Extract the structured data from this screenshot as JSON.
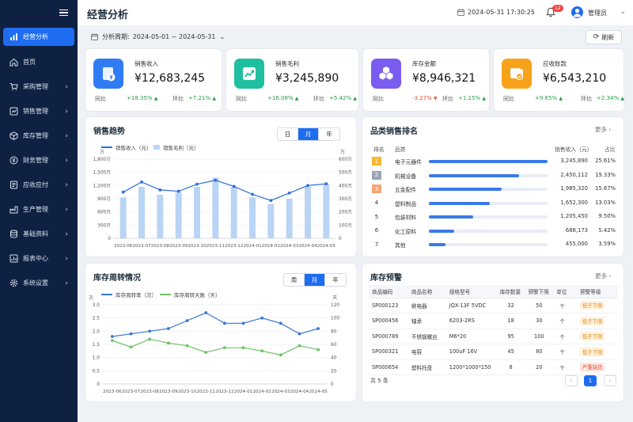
{
  "sidebar": {
    "items": [
      {
        "label": "经营分析",
        "icon": "chart-icon",
        "active": true,
        "arrow": false
      },
      {
        "label": "首页",
        "icon": "home-icon",
        "active": false,
        "arrow": false
      },
      {
        "label": "采购管理",
        "icon": "cart-icon",
        "active": false,
        "arrow": true
      },
      {
        "label": "销售管理",
        "icon": "sales-icon",
        "active": false,
        "arrow": true
      },
      {
        "label": "库存管理",
        "icon": "box-icon",
        "active": false,
        "arrow": true
      },
      {
        "label": "财务管理",
        "icon": "finance-icon",
        "active": false,
        "arrow": true
      },
      {
        "label": "应收应付",
        "icon": "invoice-icon",
        "active": false,
        "arrow": true
      },
      {
        "label": "生产管理",
        "icon": "production-icon",
        "active": false,
        "arrow": true
      },
      {
        "label": "基础资料",
        "icon": "database-icon",
        "active": false,
        "arrow": true
      },
      {
        "label": "报表中心",
        "icon": "report-icon",
        "active": false,
        "arrow": true
      },
      {
        "label": "系统设置",
        "icon": "gear-icon",
        "active": false,
        "arrow": true
      }
    ],
    "arrow_glyph": "›"
  },
  "header": {
    "title": "经营分析",
    "datetime": "2024-05-31 17:30:25",
    "notify_count": "12",
    "user": "管理员",
    "user_chevron": "⌄"
  },
  "toolbar": {
    "period_label": "分析周期:",
    "period_value": "2024-05-01 ~ 2024-05-31",
    "period_chevron": "⌄",
    "refresh_label": "刷新",
    "refresh_icon": "⟳"
  },
  "kpis": [
    {
      "label": "销售收入",
      "value": "¥12,683,245",
      "yoy_label": "同比",
      "yoy": "+18.35%",
      "yoy_dir": "up",
      "mom_label": "环比",
      "mom": "+7.21%",
      "mom_dir": "up",
      "color": "#2f7cf5",
      "icon": "money-icon"
    },
    {
      "label": "销售毛利",
      "value": "¥3,245,890",
      "yoy_label": "同比",
      "yoy": "+16.08%",
      "yoy_dir": "up",
      "mom_label": "环比",
      "mom": "+5.42%",
      "mom_dir": "up",
      "color": "#1fc0a0",
      "icon": "trend-icon"
    },
    {
      "label": "库存金额",
      "value": "¥8,946,321",
      "yoy_label": "同比",
      "yoy": "-3.27%",
      "yoy_dir": "down",
      "mom_label": "环比",
      "mom": "+1.15%",
      "mom_dir": "up",
      "color": "#7b5cf0",
      "icon": "cubes-icon"
    },
    {
      "label": "应收账款",
      "value": "¥6,543,210",
      "yoy_label": "同比",
      "yoy": "+9.65%",
      "yoy_dir": "up",
      "mom_label": "环比",
      "mom": "+2.34%",
      "mom_dir": "up",
      "color": "#f7a21b",
      "icon": "wallet-icon"
    }
  ],
  "sales_trend": {
    "title": "销售趋势",
    "tabs": [
      "日",
      "月",
      "年"
    ],
    "active_tab": 1,
    "legend": [
      "销售收入（元）",
      "销售毛利（元）"
    ],
    "left_unit": "万",
    "right_unit": "万"
  },
  "category_rank": {
    "title": "品类销售排名",
    "more": "更多 ›",
    "headers": [
      "排名",
      "品类",
      "销售收入（元）",
      "占比"
    ],
    "rows": [
      {
        "rank": "1",
        "name": "电子元器件",
        "value": "3,245,890",
        "pct": "25.61%",
        "fill": 1.0
      },
      {
        "rank": "2",
        "name": "机械设备",
        "value": "2,450,112",
        "pct": "19.33%",
        "fill": 0.76
      },
      {
        "rank": "3",
        "name": "五金配件",
        "value": "1,985,320",
        "pct": "15.67%",
        "fill": 0.61
      },
      {
        "rank": "4",
        "name": "塑料制品",
        "value": "1,652,300",
        "pct": "13.03%",
        "fill": 0.51
      },
      {
        "rank": "5",
        "name": "包装材料",
        "value": "1,205,450",
        "pct": "9.50%",
        "fill": 0.37
      },
      {
        "rank": "6",
        "name": "化工原料",
        "value": "688,173",
        "pct": "5.42%",
        "fill": 0.21
      },
      {
        "rank": "7",
        "name": "其他",
        "value": "455,000",
        "pct": "3.59%",
        "fill": 0.14
      }
    ],
    "rank_colors": [
      "#f7b733",
      "#9aa5b5",
      "#f4a571"
    ]
  },
  "turnover": {
    "title": "库存周转情况",
    "tabs": [
      "周",
      "月",
      "年"
    ],
    "active_tab": 1,
    "legend": [
      "库存周转率（次）",
      "库存周转天数（天）"
    ],
    "left_unit": "次",
    "right_unit": "天"
  },
  "stock_warning": {
    "title": "库存预警",
    "more": "更多 ›",
    "headers": [
      "商品编码",
      "商品名称",
      "规格型号",
      "库存数量",
      "预警下限",
      "单位",
      "预警等级"
    ],
    "rows": [
      [
        "SP000123",
        "继电器",
        "JQX-13F 5VDC",
        "32",
        "50",
        "个",
        "低于下限"
      ],
      [
        "SP000456",
        "轴承",
        "6203-2RS",
        "18",
        "30",
        "个",
        "低于下限"
      ],
      [
        "SP000789",
        "不锈钢螺丝",
        "M6*20",
        "95",
        "100",
        "个",
        "低于下限"
      ],
      [
        "SP000321",
        "电容",
        "100uF 16V",
        "45",
        "80",
        "个",
        "低于下限"
      ],
      [
        "SP000654",
        "塑料托盘",
        "1200*1000*150",
        "8",
        "20",
        "个",
        "严重缺货"
      ]
    ],
    "levels": [
      "low",
      "low",
      "low",
      "low",
      "high"
    ],
    "total": "共 5 条",
    "page": "1",
    "prev": "‹",
    "next": "›"
  },
  "chart_data": [
    {
      "type": "bar",
      "title": "销售趋势",
      "categories": [
        "2023-06",
        "2023-07",
        "2023-08",
        "2023-09",
        "2023-10",
        "2023-11",
        "2023-12",
        "2024-01",
        "2024-02",
        "2024-03",
        "2024-04",
        "2024-05"
      ],
      "series": [
        {
          "name": "销售收入（元）",
          "type": "line",
          "axis": "left",
          "values": [
            1050,
            1280,
            1100,
            1070,
            1230,
            1320,
            1180,
            1000,
            860,
            1030,
            1200,
            1240
          ]
        },
        {
          "name": "销售毛利（元）",
          "type": "bar",
          "axis": "right",
          "values": [
            310,
            390,
            330,
            350,
            390,
            460,
            390,
            310,
            260,
            300,
            390,
            410
          ]
        }
      ],
      "y_left": {
        "unit": "万",
        "ticks": [
          "0",
          "300万",
          "600万",
          "900万",
          "1,200万",
          "1,500万",
          "1,800万"
        ],
        "range": [
          0,
          1800
        ]
      },
      "y_right": {
        "unit": "万",
        "ticks": [
          "0",
          "100万",
          "200万",
          "300万",
          "400万",
          "500万",
          "600万"
        ],
        "range": [
          0,
          600
        ]
      },
      "colors": [
        "#2f6ed8",
        "#b9d4f5"
      ]
    },
    {
      "type": "line",
      "title": "库存周转情况",
      "categories": [
        "2023-06",
        "2023-07",
        "2023-08",
        "2023-09",
        "2023-10",
        "2023-11",
        "2023-12",
        "2024-01",
        "2024-02",
        "2024-03",
        "2024-04",
        "2024-05"
      ],
      "series": [
        {
          "name": "库存周转率（次）",
          "axis": "left",
          "values": [
            1.8,
            1.9,
            2.0,
            2.1,
            2.4,
            2.7,
            2.3,
            2.3,
            2.5,
            2.3,
            1.9,
            2.1
          ]
        },
        {
          "name": "库存周转天数（天）",
          "axis": "right",
          "values": [
            66,
            56,
            68,
            62,
            58,
            48,
            55,
            55,
            50,
            44,
            58,
            52
          ]
        }
      ],
      "y_left": {
        "unit": "次",
        "ticks": [
          "0",
          "0.5",
          "1.0",
          "1.5",
          "2.0",
          "2.5",
          "3.0"
        ],
        "range": [
          0,
          3
        ]
      },
      "y_right": {
        "unit": "天",
        "ticks": [
          "0",
          "20",
          "40",
          "60",
          "80",
          "100",
          "120"
        ],
        "range": [
          0,
          120
        ]
      },
      "colors": [
        "#3a78d8",
        "#6dc264"
      ]
    }
  ]
}
